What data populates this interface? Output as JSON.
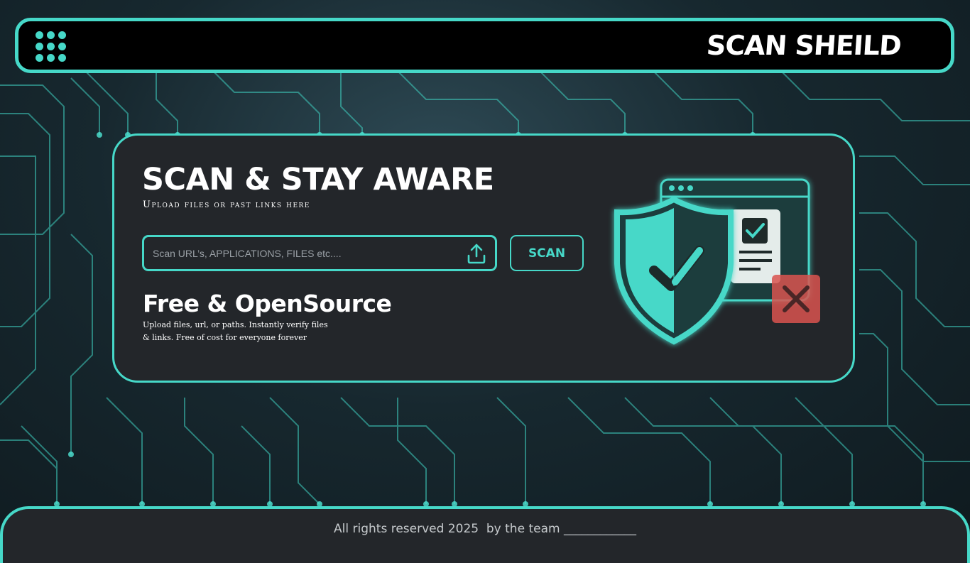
{
  "header": {
    "brand": "SCAN SHEILD",
    "menu_icon": "grid-menu-icon"
  },
  "hero": {
    "title": "SCAN & STAY AWARE",
    "subtitle": "Upload files or past links here",
    "search": {
      "placeholder": "Scan URL’s, APPLICATIONS, FILES etc....",
      "value": ""
    },
    "upload_icon": "upload-icon",
    "scan_label": "SCAN",
    "free_title": "Free & OpenSource",
    "free_desc": "Upload files, url, or paths. Instantly verify files & links. Free of cost for everyone forever"
  },
  "footer": {
    "text": "All rights reserved 2025  by the team ____________"
  },
  "colors": {
    "accent": "#46d8c8",
    "card_bg": "#23262a",
    "header_bg": "#000000",
    "danger": "#e05a5a"
  }
}
